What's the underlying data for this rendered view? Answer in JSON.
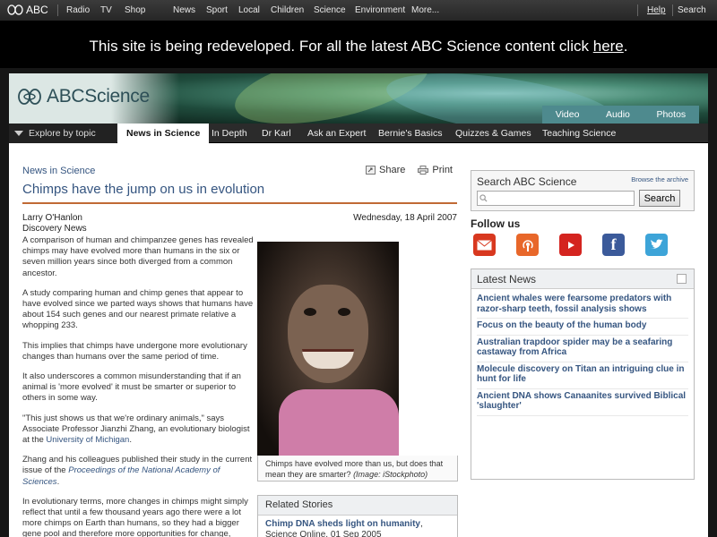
{
  "global_nav": {
    "logo_text": "ABC",
    "left_items": [
      "Radio",
      "TV",
      "Shop"
    ],
    "center_items": [
      "News",
      "Sport",
      "Local",
      "Children",
      "Science",
      "Environment",
      "More..."
    ],
    "right_items": [
      "Help",
      "Search"
    ]
  },
  "banner": {
    "text": "This site is being redeveloped. For all the latest ABC Science content click",
    "link": "here",
    "period": "."
  },
  "header": {
    "brand_abc": "ABC",
    "brand_science": "Science",
    "media_tabs": [
      "Video",
      "Audio",
      "Photos"
    ]
  },
  "nav": {
    "explore": "Explore by topic",
    "items": [
      "News in Science",
      "In Depth",
      "Dr Karl",
      "Ask an Expert",
      "Bernie's Basics",
      "Quizzes & Games",
      "Teaching Science"
    ],
    "active": "News in Science"
  },
  "article": {
    "section": "News in Science",
    "tools": {
      "share": "Share",
      "print": "Print"
    },
    "headline": "Chimps have the jump on us in evolution",
    "author": "Larry O'Hanlon",
    "source": "Discovery News",
    "date": "Wednesday, 18 April 2007",
    "paragraphs": {
      "p1": "A comparison of human and chimpanzee genes has revealed chimps may have evolved more than humans in the six or seven million years since both diverged from a common ancestor.",
      "p2": "A study comparing human and chimp genes that appear to have evolved since we parted ways shows that humans have about 154 such genes and our nearest primate relative a whopping 233.",
      "p3": "This implies that chimps have undergone more evolutionary changes than humans over the same period of time.",
      "p4": "It also underscores a common misunderstanding that if an animal is 'more evolved' it must be smarter or superior to others in some way.",
      "p5_a": "\"This just shows us that we're ordinary animals,\" says Associate Professor Jianzhi Zhang, an evolutionary biologist at the",
      "p5_link": "University of Michigan",
      "p5_b": ".",
      "p6_a": "Zhang and his colleagues published their study in the current issue of the",
      "p6_link": "Proceedings of the National Academy of Sciences",
      "p6_b": ".",
      "p7": "In evolutionary terms, more changes in chimps might simply reflect that until a few thousand years ago there were a lot more chimps on Earth than humans, so they had a bigger gene pool and therefore more opportunities for change,"
    },
    "caption": "Chimps have evolved more than us, but does that mean they are smarter?",
    "credit": "(Image: iStockphoto)"
  },
  "related": {
    "title": "Related Stories",
    "item_title": "Chimp DNA sheds light on humanity",
    "item_source": ", Science Online, 01 Sep 2005"
  },
  "sidebar": {
    "search_label": "Search ABC Science",
    "browse": "Browse the archive",
    "search_button": "Search",
    "search_value": "",
    "follow": "Follow us",
    "social": [
      "email-icon",
      "podcast-icon",
      "youtube-icon",
      "facebook-icon",
      "twitter-icon"
    ],
    "social_colors": [
      "#d8381f",
      "#e8672a",
      "#d4241f",
      "#3b5a9a",
      "#3da4d8"
    ],
    "latest_title": "Latest News",
    "latest": [
      "Ancient whales were fearsome predators with razor-sharp teeth, fossil analysis shows",
      "Focus on the beauty of the human body",
      "Australian trapdoor spider may be a seafaring castaway from Africa",
      "Molecule discovery on Titan an intriguing clue in hunt for life",
      "Ancient DNA shows Canaanites survived Biblical 'slaughter'"
    ]
  }
}
